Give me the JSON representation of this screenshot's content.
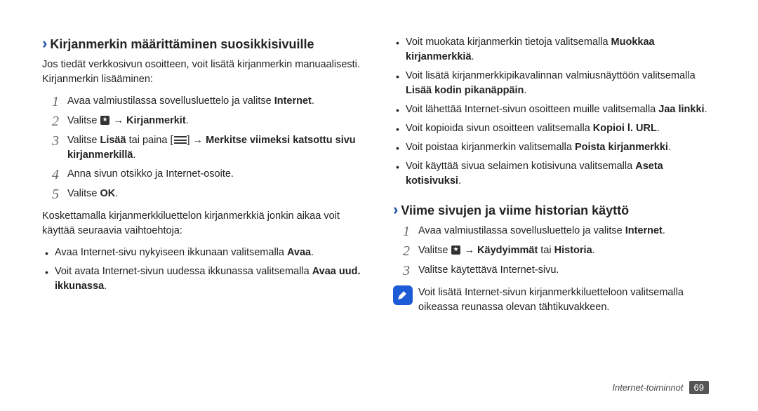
{
  "left": {
    "heading": "Kirjanmerkin määrittäminen suosikkisivuille",
    "intro": "Jos tiedät verkkosivun osoitteen, voit lisätä kirjanmerkin manuaalisesti. Kirjanmerkin lisääminen:",
    "step1_a": "Avaa valmiustilassa sovellusluettelo ja valitse ",
    "step1_b": "Internet",
    "step2_a": "Valitse ",
    "step2_b": " → ",
    "step2_c": "Kirjanmerkit",
    "step3_a": "Valitse ",
    "step3_b": "Lisää",
    "step3_c": " tai paina [",
    "step3_d": "] → ",
    "step3_e": "Merkitse viimeksi katsottu sivu kirjanmerkillä",
    "step4": "Anna sivun otsikko ja Internet-osoite.",
    "step5_a": "Valitse ",
    "step5_b": "OK",
    "para2": "Koskettamalla kirjanmerkkiluettelon kirjanmerkkiä jonkin aikaa voit käyttää seuraavia vaihtoehtoja:",
    "bul1_a": "Avaa Internet-sivu nykyiseen ikkunaan valitsemalla ",
    "bul1_b": "Avaa",
    "bul2_a": "Voit avata Internet-sivun uudessa ikkunassa valitsemalla ",
    "bul2_b": "Avaa uud. ikkunassa"
  },
  "right": {
    "bul1_a": "Voit muokata kirjanmerkin tietoja valitsemalla ",
    "bul1_b": "Muokkaa kirjanmerkkiä",
    "bul2_a": "Voit lisätä kirjanmerkkipikavalinnan valmiusnäyttöön valitsemalla ",
    "bul2_b": "Lisää kodin pikanäppäin",
    "bul3_a": "Voit lähettää Internet-sivun osoitteen muille valitsemalla ",
    "bul3_b": "Jaa linkki",
    "bul4_a": "Voit kopioida sivun osoitteen valitsemalla ",
    "bul4_b": "Kopioi l. URL",
    "bul5_a": "Voit poistaa kirjanmerkin valitsemalla ",
    "bul5_b": "Poista kirjanmerkki",
    "bul6_a": "Voit käyttää sivua selaimen kotisivuna valitsemalla ",
    "bul6_b": "Aseta kotisivuksi",
    "heading2": "Viime sivujen ja viime historian käyttö",
    "step1_a": "Avaa valmiustilassa sovellusluettelo ja valitse ",
    "step1_b": "Internet",
    "step2_a": "Valitse ",
    "step2_b": " → ",
    "step2_c": "Käydyimmät",
    "step2_d": " tai ",
    "step2_e": "Historia",
    "step3": "Valitse käytettävä Internet-sivu.",
    "note": "Voit lisätä Internet-sivun kirjanmerkkiluetteloon valitsemalla oikeassa reunassa olevan tähtikuvakkeen."
  },
  "footer": {
    "label": "Internet-toiminnot",
    "page": "69"
  }
}
